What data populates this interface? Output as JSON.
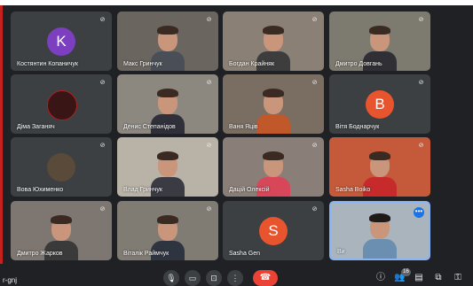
{
  "colors": {
    "background": "#202124",
    "tile": "#3c4043",
    "hangup": "#ea4335",
    "accent": "#1a73e8",
    "avatar_k": "#7b3fbf",
    "avatar_v": "#e8542d",
    "avatar_s": "#e8542d"
  },
  "participants": [
    {
      "name": "Костянтин Копаничук",
      "initial": "K",
      "kind": "letter"
    },
    {
      "name": "Макс Гринчук",
      "kind": "video"
    },
    {
      "name": "Богдан Крайняк",
      "kind": "video"
    },
    {
      "name": "Дмитро Довгань",
      "kind": "video"
    },
    {
      "name": "Діма Заганяч",
      "kind": "photo"
    },
    {
      "name": "Денис Степанідов",
      "kind": "video"
    },
    {
      "name": "Ваня Яців",
      "kind": "video"
    },
    {
      "name": "Вітя Боднарчук",
      "initial": "B",
      "kind": "letter"
    },
    {
      "name": "Вова Юхименко",
      "kind": "photo"
    },
    {
      "name": "Влад Гринчук",
      "kind": "video"
    },
    {
      "name": "Дацій Олексій",
      "kind": "video"
    },
    {
      "name": "Sasha Boiko",
      "kind": "video"
    },
    {
      "name": "Дмитро Жарков",
      "kind": "video"
    },
    {
      "name": "Віталік Раймчук",
      "kind": "video"
    },
    {
      "name": "Sasha Gen",
      "initial": "S",
      "kind": "letter"
    },
    {
      "name": "Ви",
      "kind": "self"
    }
  ],
  "bottom_bar": {
    "meeting_code": "r-gnj",
    "participant_count": "16",
    "icons": {
      "mic": "mic-icon",
      "camera": "camera-icon",
      "present": "present-icon",
      "more": "more-options-icon",
      "hangup": "hangup-icon",
      "info": "info-icon",
      "people": "people-icon",
      "chat": "chat-icon",
      "activities": "activities-icon",
      "lock": "host-controls-icon"
    }
  }
}
